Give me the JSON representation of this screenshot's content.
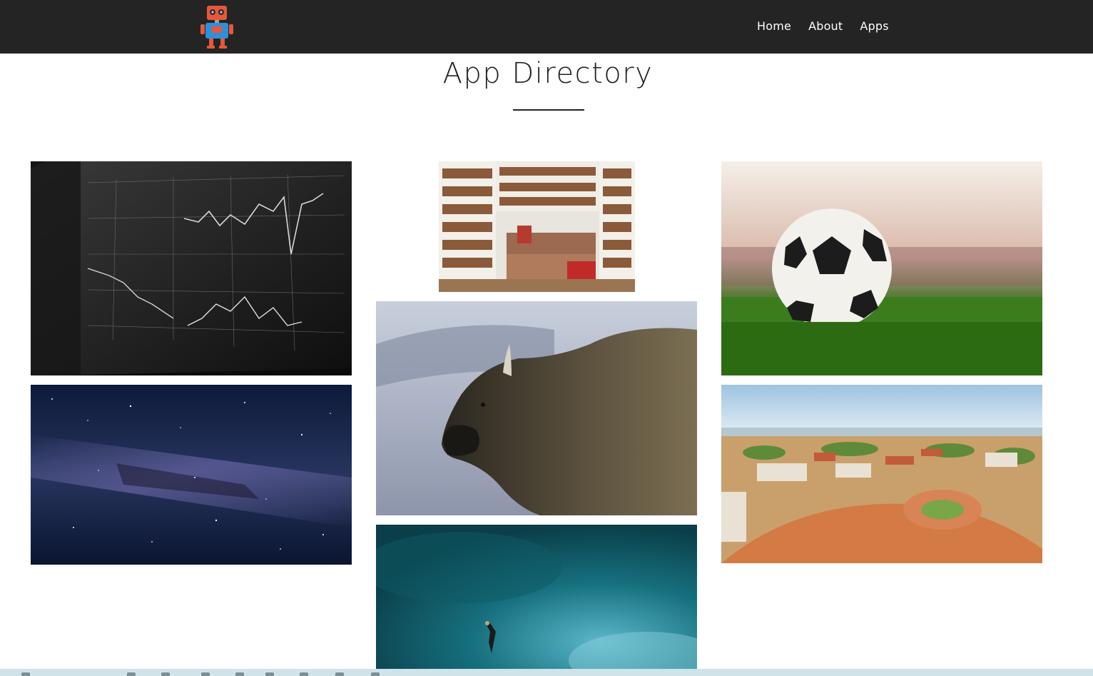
{
  "header": {
    "logo_icon": "robot-icon",
    "colors": {
      "background": "#242424",
      "link": "#ffffff"
    }
  },
  "nav": {
    "items": [
      {
        "label": "Home"
      },
      {
        "label": "About"
      },
      {
        "label": "Apps"
      }
    ]
  },
  "main": {
    "title": "App Directory"
  },
  "apps": {
    "tiles": [
      {
        "image": "stock-chart-monitor"
      },
      {
        "image": "milky-way-night-sky"
      },
      {
        "image": "bookshelf-reading-room"
      },
      {
        "image": "bison-profile"
      },
      {
        "image": "diver-in-ocean"
      },
      {
        "image": "soccer-ball-stadium"
      },
      {
        "image": "city-roundabout-aerial"
      }
    ]
  }
}
